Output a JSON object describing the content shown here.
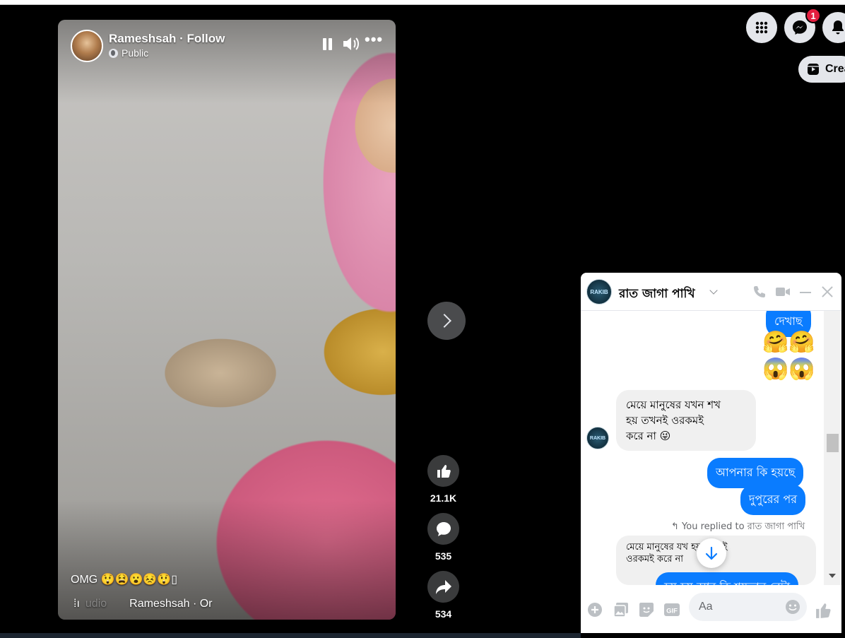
{
  "video": {
    "poster_name": "Rameshsah · Follow",
    "privacy": "Public",
    "caption": "OMG 😲😫😮😣😲▯",
    "audio_label": "udio",
    "audio_source": "Rameshsah · Or"
  },
  "actions": {
    "likes": "21.1K",
    "comments": "535",
    "shares": "534"
  },
  "topbar": {
    "messenger_badge": "1",
    "create_label": "Crea"
  },
  "chat": {
    "title": "রাত জাগা পাখি",
    "avatar_text": "RAKIB",
    "messages": {
      "out_top": "দেখাছ",
      "emoji_row1": "🤗🤗",
      "emoji_row2": "😱😱",
      "in_line1": "মেয়ে মানুষের যখন শখ",
      "in_line2": "হয় তখনই ওরকমই",
      "in_line3": "করে না 😜",
      "out_1": "আপনার কি হয়ছে",
      "out_2": "দুপুরের পর",
      "replied_note": "↰ You replied to রাত জাগা পাখি",
      "quoted_line1": "মেয়ে মানুষের যখ     হয় তখনই",
      "quoted_line2": "ওরকমই করে না",
      "out_partial": "হয় হয় আর কি শয়তান বেটা"
    },
    "input_placeholder": "Aa"
  }
}
